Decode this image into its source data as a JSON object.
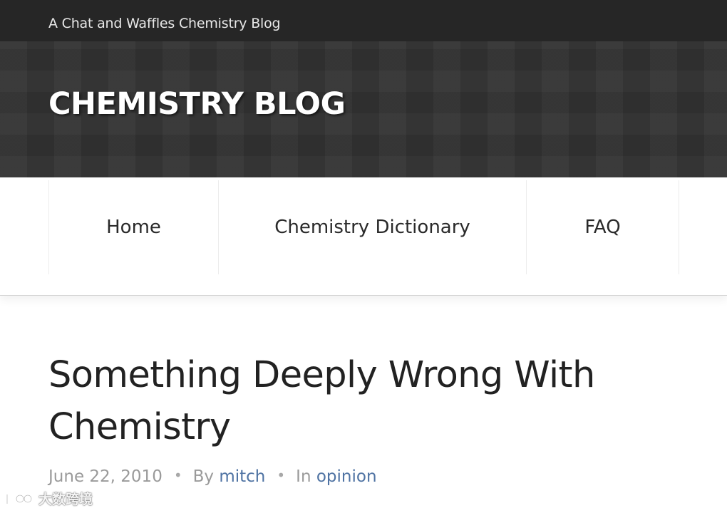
{
  "header": {
    "tagline": "A Chat and Waffles Chemistry Blog",
    "site_title": "CHEMISTRY BLOG"
  },
  "nav": {
    "items": [
      {
        "label": "Home"
      },
      {
        "label": "Chemistry Dictionary"
      },
      {
        "label": "FAQ"
      }
    ]
  },
  "post": {
    "title": "Something Deeply Wrong With Chemistry",
    "date": "June 22, 2010",
    "by_label": "By",
    "author": "mitch",
    "in_label": "In",
    "category": "opinion",
    "separator": "•"
  },
  "watermark": {
    "text": "大数跨境"
  },
  "colors": {
    "topbar": "#262626",
    "hero": "#323232",
    "link": "#4f73a3",
    "meta": "#9a9a9a"
  }
}
